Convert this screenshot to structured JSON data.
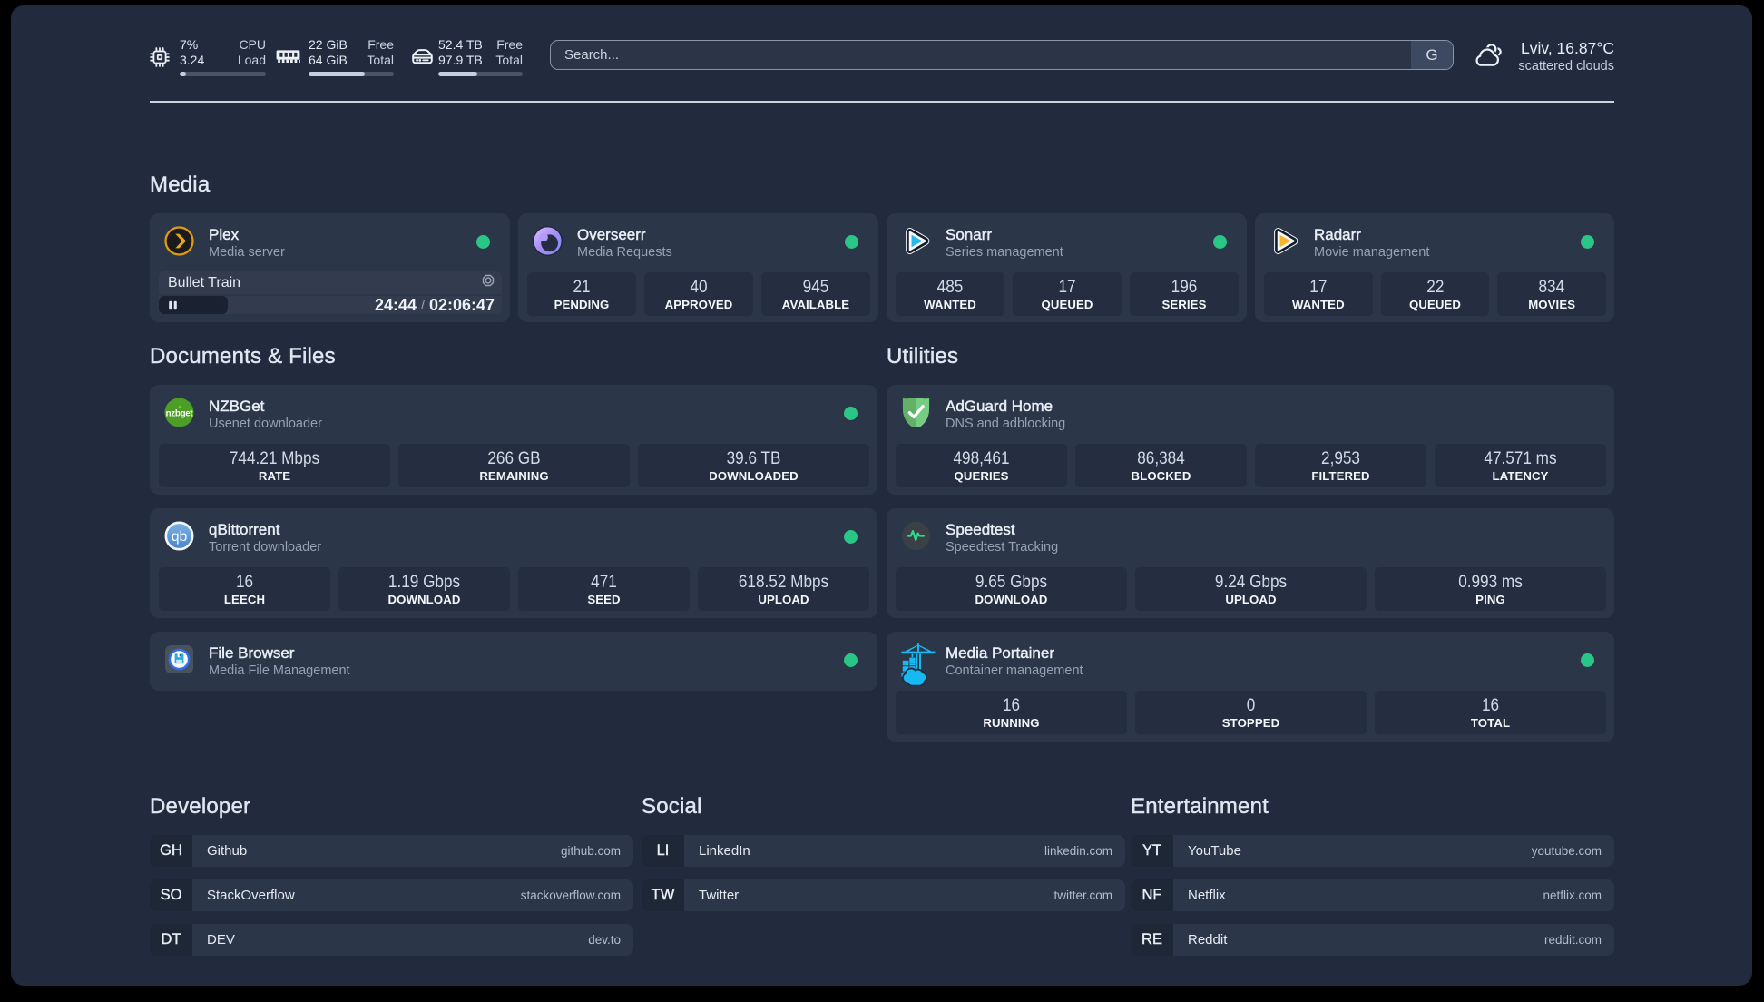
{
  "topbar": {
    "resources": [
      {
        "icon": "cpu-icon",
        "rows": [
          {
            "left": "7%",
            "right": "CPU"
          },
          {
            "left": "3.24",
            "right": "Load"
          }
        ],
        "progress_pct": 7
      },
      {
        "icon": "memory-icon",
        "rows": [
          {
            "left": "22 GiB",
            "right": "Free"
          },
          {
            "left": "64 GiB",
            "right": "Total"
          }
        ],
        "progress_pct": 65.6
      },
      {
        "icon": "disk-icon",
        "rows": [
          {
            "left": "52.4 TB",
            "right": "Free"
          },
          {
            "left": "97.9 TB",
            "right": "Total"
          }
        ],
        "progress_pct": 46.5
      }
    ],
    "search": {
      "placeholder": "Search...",
      "button_label": "G"
    },
    "weather": {
      "icon": "scattered-clouds-icon",
      "line1": "Lviv, 16.87°C",
      "line2": "scattered clouds"
    }
  },
  "sections": {
    "media": {
      "title": "Media",
      "cards": [
        {
          "name": "Plex",
          "description": "Media server",
          "icon": "plex-icon",
          "status": "online",
          "player": {
            "title": "Bullet Train",
            "position": "24:44",
            "separator": "/",
            "duration": "02:06:47"
          }
        },
        {
          "name": "Overseerr",
          "description": "Media Requests",
          "icon": "overseerr-icon",
          "status": "online",
          "stats": [
            {
              "value": "21",
              "label": "PENDING"
            },
            {
              "value": "40",
              "label": "APPROVED"
            },
            {
              "value": "945",
              "label": "AVAILABLE"
            }
          ]
        },
        {
          "name": "Sonarr",
          "description": "Series management",
          "icon": "sonarr-icon",
          "status": "online",
          "stats": [
            {
              "value": "485",
              "label": "WANTED"
            },
            {
              "value": "17",
              "label": "QUEUED"
            },
            {
              "value": "196",
              "label": "SERIES"
            }
          ]
        },
        {
          "name": "Radarr",
          "description": "Movie management",
          "icon": "radarr-icon",
          "status": "online",
          "stats": [
            {
              "value": "17",
              "label": "WANTED"
            },
            {
              "value": "22",
              "label": "QUEUED"
            },
            {
              "value": "834",
              "label": "MOVIES"
            }
          ]
        }
      ]
    },
    "documents": {
      "title": "Documents & Files",
      "cards": [
        {
          "name": "NZBGet",
          "description": "Usenet downloader",
          "icon": "nzbget-icon",
          "status": "online",
          "stats": [
            {
              "value": "744.21 Mbps",
              "label": "RATE"
            },
            {
              "value": "266 GB",
              "label": "REMAINING"
            },
            {
              "value": "39.6 TB",
              "label": "DOWNLOADED"
            }
          ]
        },
        {
          "name": "qBittorrent",
          "description": "Torrent downloader",
          "icon": "qbittorrent-icon",
          "status": "online",
          "stats": [
            {
              "value": "16",
              "label": "LEECH"
            },
            {
              "value": "1.19 Gbps",
              "label": "DOWNLOAD"
            },
            {
              "value": "471",
              "label": "SEED"
            },
            {
              "value": "618.52 Mbps",
              "label": "UPLOAD"
            }
          ]
        },
        {
          "name": "File Browser",
          "description": "Media File Management",
          "icon": "filebrowser-icon",
          "status": "online"
        }
      ]
    },
    "utilities": {
      "title": "Utilities",
      "cards": [
        {
          "name": "AdGuard Home",
          "description": "DNS and adblocking",
          "icon": "adguard-icon",
          "status": "none",
          "stats": [
            {
              "value": "498,461",
              "label": "QUERIES"
            },
            {
              "value": "86,384",
              "label": "BLOCKED"
            },
            {
              "value": "2,953",
              "label": "FILTERED"
            },
            {
              "value": "47.571 ms",
              "label": "LATENCY"
            }
          ]
        },
        {
          "name": "Speedtest",
          "description": "Speedtest Tracking",
          "icon": "speedtest-icon",
          "status": "none",
          "stats": [
            {
              "value": "9.65 Gbps",
              "label": "DOWNLOAD"
            },
            {
              "value": "9.24 Gbps",
              "label": "UPLOAD"
            },
            {
              "value": "0.993 ms",
              "label": "PING"
            }
          ]
        },
        {
          "name": "Media Portainer",
          "description": "Container management",
          "icon": "portainer-icon",
          "status": "online",
          "stats": [
            {
              "value": "16",
              "label": "RUNNING"
            },
            {
              "value": "0",
              "label": "STOPPED"
            },
            {
              "value": "16",
              "label": "TOTAL"
            }
          ]
        }
      ]
    },
    "bookmarks": [
      {
        "title": "Developer",
        "items": [
          {
            "abbr": "GH",
            "name": "Github",
            "url": "github.com"
          },
          {
            "abbr": "SO",
            "name": "StackOverflow",
            "url": "stackoverflow.com"
          },
          {
            "abbr": "DT",
            "name": "DEV",
            "url": "dev.to"
          }
        ]
      },
      {
        "title": "Social",
        "items": [
          {
            "abbr": "LI",
            "name": "LinkedIn",
            "url": "linkedin.com"
          },
          {
            "abbr": "TW",
            "name": "Twitter",
            "url": "twitter.com"
          }
        ]
      },
      {
        "title": "Entertainment",
        "items": [
          {
            "abbr": "YT",
            "name": "YouTube",
            "url": "youtube.com"
          },
          {
            "abbr": "NF",
            "name": "Netflix",
            "url": "netflix.com"
          },
          {
            "abbr": "RE",
            "name": "Reddit",
            "url": "reddit.com"
          }
        ]
      }
    ]
  },
  "colors": {
    "status_online": "#26c281",
    "progress_fill": "#c6cfdd",
    "accent_green": "#2fd98a"
  }
}
